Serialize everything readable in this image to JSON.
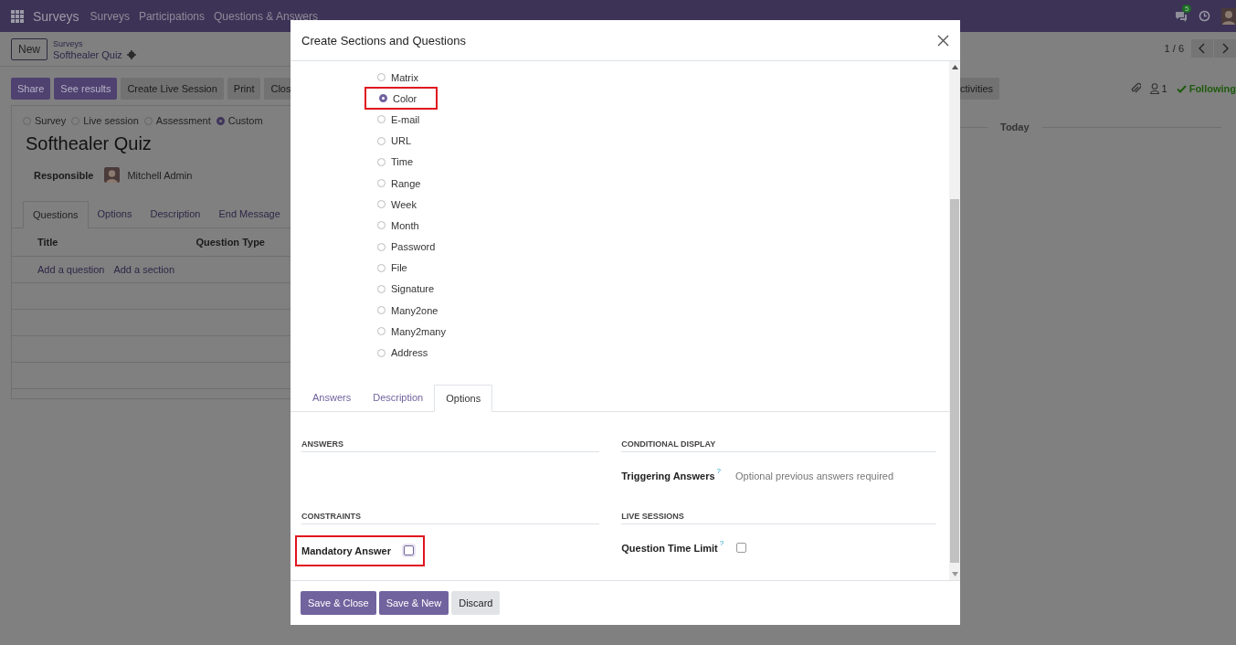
{
  "navbar": {
    "app": "Surveys",
    "menu": [
      "Surveys",
      "Participations",
      "Questions & Answers"
    ],
    "message_count": "5"
  },
  "control_panel": {
    "new_button": "New",
    "breadcrumb": "Surveys",
    "record": "Softhealer Quiz",
    "pager": "1 / 6"
  },
  "action_buttons": [
    {
      "label": "Share",
      "kind": "primary"
    },
    {
      "label": "See results",
      "kind": "primary"
    },
    {
      "label": "Create Live Session",
      "kind": "secondary"
    },
    {
      "label": "Print",
      "kind": "secondary"
    },
    {
      "label": "Clos",
      "kind": "secondary"
    }
  ],
  "chatter": {
    "activities_button": "ctivities",
    "followers": "1",
    "following": "Following",
    "date_separator": "Today"
  },
  "form": {
    "survey_types": [
      {
        "label": "Survey",
        "selected": false
      },
      {
        "label": "Live session",
        "selected": false
      },
      {
        "label": "Assessment",
        "selected": false
      },
      {
        "label": "Custom",
        "selected": true
      }
    ],
    "title": "Softhealer Quiz",
    "responsible_label": "Responsible",
    "responsible": "Mitchell Admin",
    "tabs": [
      {
        "label": "Questions",
        "selected": true
      },
      {
        "label": "Options",
        "selected": false
      },
      {
        "label": "Description",
        "selected": false
      },
      {
        "label": "End Message",
        "selected": false
      }
    ],
    "columns": [
      "Title",
      "Question Type"
    ],
    "add_links": [
      "Add a question",
      "Add a section"
    ]
  },
  "dialog": {
    "title": "Create Sections and Questions",
    "question_types": [
      {
        "label": "Matrix",
        "selected": false,
        "highlighted": false
      },
      {
        "label": "Color",
        "selected": true,
        "highlighted": true
      },
      {
        "label": "E-mail",
        "selected": false,
        "highlighted": false
      },
      {
        "label": "URL",
        "selected": false,
        "highlighted": false
      },
      {
        "label": "Time",
        "selected": false,
        "highlighted": false
      },
      {
        "label": "Range",
        "selected": false,
        "highlighted": false
      },
      {
        "label": "Week",
        "selected": false,
        "highlighted": false
      },
      {
        "label": "Month",
        "selected": false,
        "highlighted": false
      },
      {
        "label": "Password",
        "selected": false,
        "highlighted": false
      },
      {
        "label": "File",
        "selected": false,
        "highlighted": false
      },
      {
        "label": "Signature",
        "selected": false,
        "highlighted": false
      },
      {
        "label": "Many2one",
        "selected": false,
        "highlighted": false
      },
      {
        "label": "Many2many",
        "selected": false,
        "highlighted": false
      },
      {
        "label": "Address",
        "selected": false,
        "highlighted": false
      }
    ],
    "tabs": [
      {
        "label": "Answers",
        "selected": false
      },
      {
        "label": "Description",
        "selected": false
      },
      {
        "label": "Options",
        "selected": true
      }
    ],
    "sections": [
      {
        "heading": "ANSWERS"
      },
      {
        "heading": "CONDITIONAL DISPLAY",
        "fields": [
          {
            "label": "Triggering Answers",
            "help": "?",
            "kind": "text",
            "placeholder": "Optional previous answers required",
            "highlighted": false
          }
        ]
      },
      {
        "heading": "CONSTRAINTS",
        "fields": [
          {
            "label": "Mandatory Answer",
            "kind": "checkbox",
            "checked": false,
            "highlighted": true
          }
        ]
      },
      {
        "heading": "LIVE SESSIONS",
        "fields": [
          {
            "label": "Question Time Limit",
            "help": "?",
            "kind": "checkbox",
            "checked": false,
            "highlighted": false
          }
        ]
      }
    ],
    "buttons": [
      {
        "label": "Save & Close",
        "kind": "primary"
      },
      {
        "label": "Save & New",
        "kind": "primary"
      },
      {
        "label": "Discard",
        "kind": "secondary"
      }
    ]
  }
}
